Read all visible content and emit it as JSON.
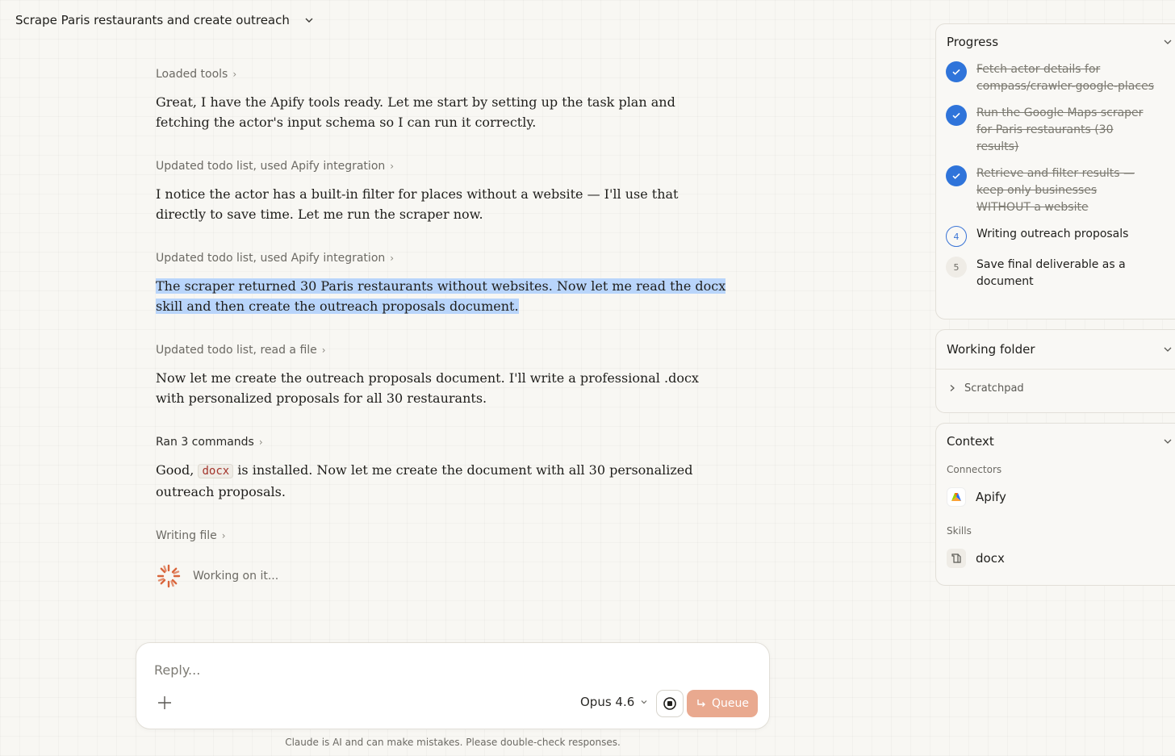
{
  "header": {
    "title": "Scrape Paris restaurants and create outreach"
  },
  "chat": {
    "items": [
      {
        "type": "step",
        "label": "Loaded tools"
      },
      {
        "type": "msg",
        "text": "Great, I have the Apify tools ready. Let me start by setting up the task plan and fetching the actor's input schema so I can run it correctly."
      },
      {
        "type": "step",
        "label": "Updated todo list, used Apify integration"
      },
      {
        "type": "msg",
        "text": "I notice the actor has a built-in filter for places without a website — I'll use that directly to save time. Let me run the scraper now."
      },
      {
        "type": "step",
        "label": "Updated todo list, used Apify integration"
      },
      {
        "type": "msg",
        "text": "The scraper returned 30 Paris restaurants without websites. Now let me read the docx skill and then create the outreach proposals document."
      },
      {
        "type": "step",
        "label": "Updated todo list, read a file"
      },
      {
        "type": "msg",
        "text": "Now let me create the outreach proposals document. I'll write a professional .docx with personalized proposals for all 30 restaurants."
      },
      {
        "type": "step",
        "label": "Ran 3 commands"
      },
      {
        "type": "msg",
        "pre": "Good,",
        "code": "docx",
        "post": "is installed. Now let me create the document with all 30 personalized outreach proposals."
      },
      {
        "type": "step",
        "label": "Writing file"
      }
    ],
    "working": "Working on it..."
  },
  "reply": {
    "placeholder": "Reply...",
    "model": "Opus 4.6",
    "queue_label": "Queue",
    "disclaimer": "Claude is AI and can make mistakes. Please double-check responses."
  },
  "progress": {
    "title": "Progress",
    "items": [
      {
        "num": "1",
        "status": "done",
        "text": "Fetch actor details for compass/crawler-google-places"
      },
      {
        "num": "2",
        "status": "done",
        "text": "Run the Google Maps scraper for Paris restaurants (30 results)"
      },
      {
        "num": "3",
        "status": "done",
        "text": "Retrieve and filter results — keep only businesses WITHOUT a website"
      },
      {
        "num": "4",
        "status": "active",
        "text": "Writing outreach proposals"
      },
      {
        "num": "5",
        "status": "pending",
        "text": "Save final deliverable as a document"
      }
    ]
  },
  "working_folder": {
    "title": "Working folder",
    "item": "Scratchpad"
  },
  "context": {
    "title": "Context",
    "connectors_label": "Connectors",
    "connector": "Apify",
    "skills_label": "Skills",
    "skill": "docx"
  },
  "colors": {
    "accent": "#2f74da",
    "highlight": "#b9d5fb",
    "queue": "#e9a98f",
    "spinner": "#d9653b"
  }
}
